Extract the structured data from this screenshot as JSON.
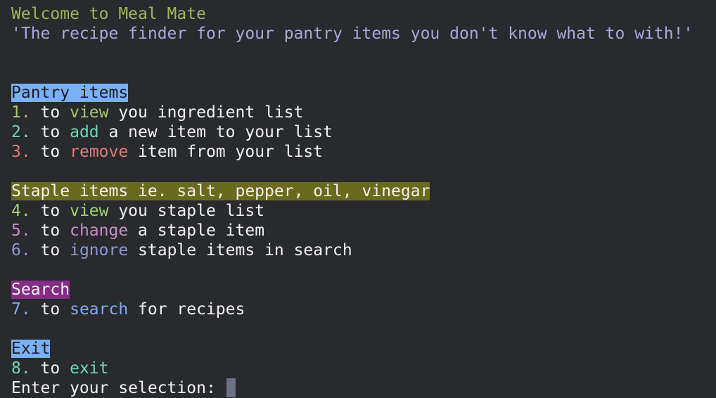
{
  "header": {
    "welcome": "Welcome to Meal Mate",
    "tagline": "'The recipe finder for your pantry items you don't know what to with!'"
  },
  "sections": {
    "pantry": {
      "heading": "Pantry items",
      "options": [
        {
          "num": "1.",
          "pre": " to ",
          "verb": "view",
          "rest": " you ingredient list"
        },
        {
          "num": "2.",
          "pre": " to ",
          "verb": "add",
          "rest": " a new item to your list"
        },
        {
          "num": "3.",
          "pre": " to ",
          "verb": "remove",
          "rest": " item from your list"
        }
      ]
    },
    "staple": {
      "heading": "Staple items ie. salt, pepper, oil, vinegar",
      "options": [
        {
          "num": "4.",
          "pre": " to ",
          "verb": "view",
          "rest": " you staple list"
        },
        {
          "num": "5.",
          "pre": " to ",
          "verb": "change",
          "rest": " a staple item"
        },
        {
          "num": "6.",
          "pre": " to ",
          "verb": "ignore",
          "rest": " staple items in search"
        }
      ]
    },
    "search": {
      "heading": "Search",
      "options": [
        {
          "num": "7.",
          "pre": " to ",
          "verb": "search",
          "rest": " for recipes"
        }
      ]
    },
    "exit": {
      "heading": "Exit",
      "options": [
        {
          "num": "8.",
          "pre": " to ",
          "verb": "exit",
          "rest": ""
        }
      ]
    }
  },
  "prompt": {
    "label": "Enter your selection: "
  },
  "colors": {
    "background": "#282a2e",
    "heading_pantry_bg": "#7ab0f5",
    "heading_staple_bg": "#6a6a1c",
    "heading_search_bg": "#842d85",
    "heading_exit_bg": "#7ab0f5"
  }
}
